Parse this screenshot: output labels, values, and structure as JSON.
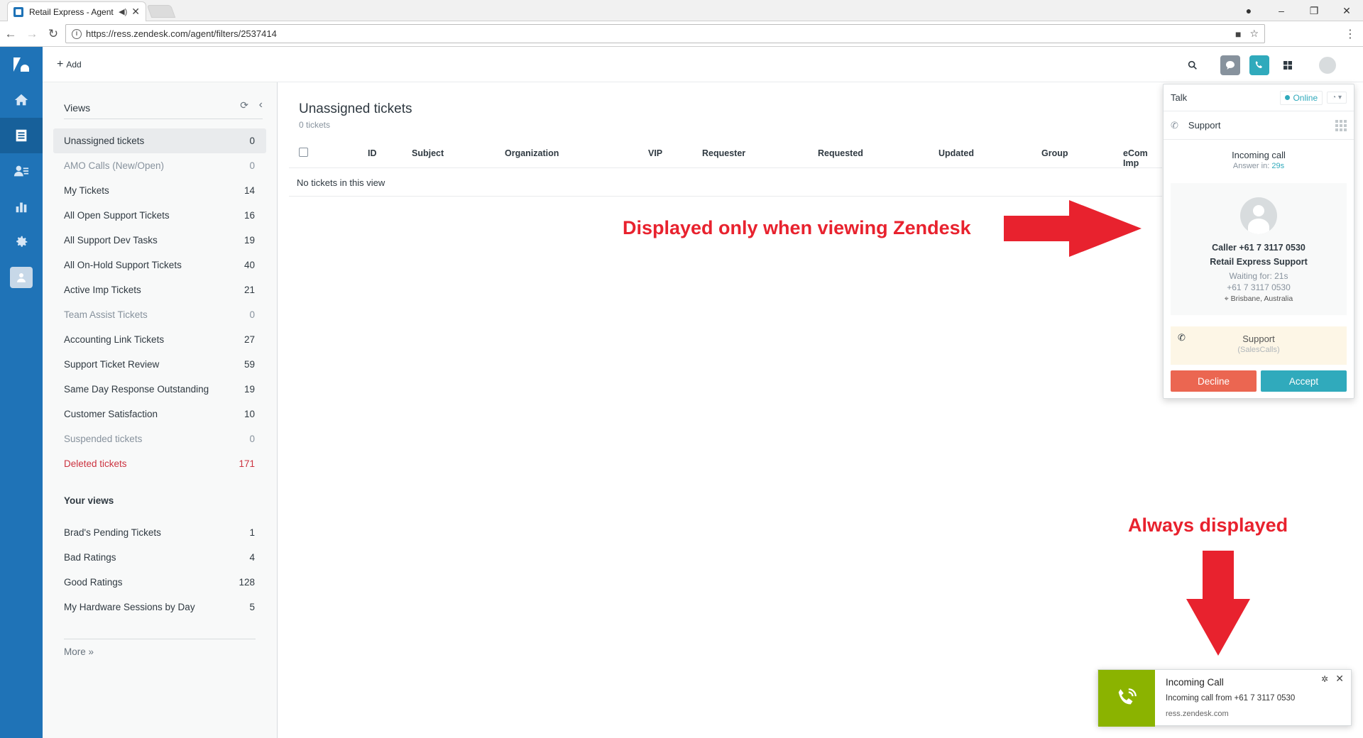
{
  "browser": {
    "tab_title": "Retail Express - Agent",
    "url": "https://ress.zendesk.com/agent/filters/2537414"
  },
  "header": {
    "add_label": "Add"
  },
  "views": {
    "title": "Views",
    "items": [
      {
        "label": "Unassigned tickets",
        "count": "0"
      },
      {
        "label": "AMO Calls (New/Open)",
        "count": "0"
      },
      {
        "label": "My Tickets",
        "count": "14"
      },
      {
        "label": "All Open Support Tickets",
        "count": "16"
      },
      {
        "label": "All Support Dev Tasks",
        "count": "19"
      },
      {
        "label": "All On-Hold Support Tickets",
        "count": "40"
      },
      {
        "label": "Active Imp Tickets",
        "count": "21"
      },
      {
        "label": "Team Assist Tickets",
        "count": "0"
      },
      {
        "label": "Accounting Link Tickets",
        "count": "27"
      },
      {
        "label": "Support Ticket Review",
        "count": "59"
      },
      {
        "label": "Same Day Response Outstanding",
        "count": "19"
      },
      {
        "label": "Customer Satisfaction",
        "count": "10"
      },
      {
        "label": "Suspended tickets",
        "count": "0"
      },
      {
        "label": "Deleted tickets",
        "count": "171"
      }
    ],
    "your_views_title": "Your views",
    "your_views": [
      {
        "label": "Brad's Pending Tickets",
        "count": "1"
      },
      {
        "label": "Bad Ratings",
        "count": "4"
      },
      {
        "label": "Good Ratings",
        "count": "128"
      },
      {
        "label": "My Hardware Sessions by Day",
        "count": "5"
      }
    ],
    "more_label": "More »"
  },
  "main": {
    "title": "Unassigned tickets",
    "subtitle": "0 tickets",
    "columns": [
      "ID",
      "Subject",
      "Organization",
      "VIP",
      "Requester",
      "Requested",
      "Updated",
      "Group",
      "eCom Imp"
    ],
    "empty_text": "No tickets in this view"
  },
  "annotations": {
    "first": "Displayed only when viewing Zendesk",
    "second": "Always displayed",
    "color": "#e8222e"
  },
  "talk": {
    "title": "Talk",
    "status": "Online",
    "line": "Support",
    "incoming": "Incoming call",
    "answer_prefix": "Answer in: ",
    "answer_time": "29s",
    "caller_line": "Caller +61 7 3117 0530",
    "caller_company": "Retail Express Support",
    "waiting": "Waiting for: 21s",
    "number": "+61 7 3117 0530",
    "location": "Brisbane, Australia",
    "queue_name": "Support",
    "queue_sub": "(SalesCalls)",
    "decline": "Decline",
    "accept": "Accept"
  },
  "toast": {
    "title": "Incoming Call",
    "body": "Incoming call from +61 7 3117 0530",
    "source": "ress.zendesk.com"
  }
}
